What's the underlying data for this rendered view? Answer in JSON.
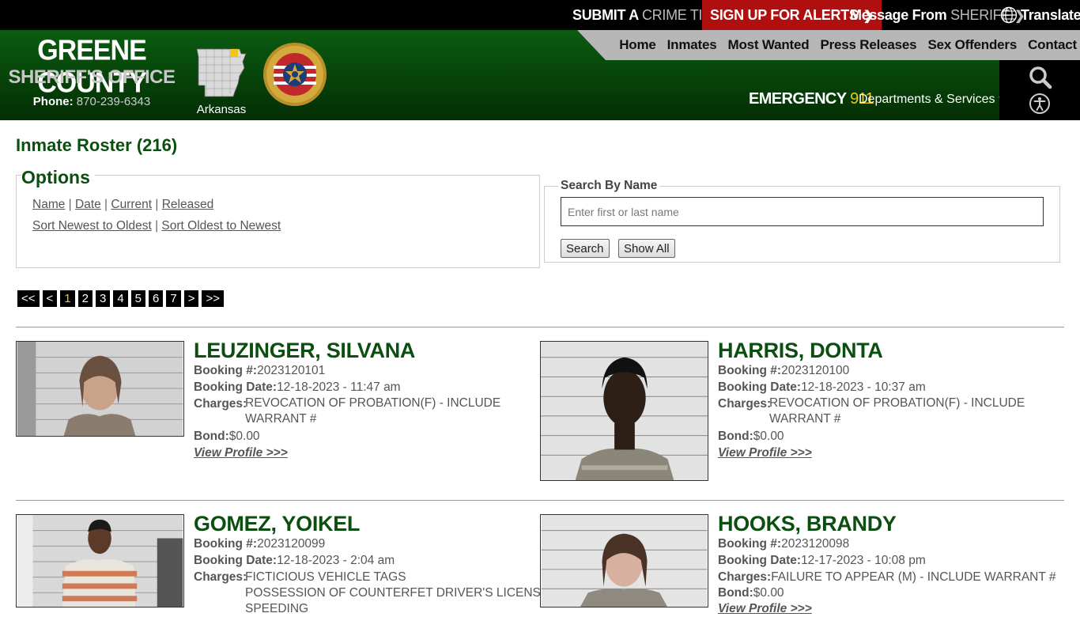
{
  "topbar": {
    "crime_tip_bold": "SUBMIT A",
    "crime_tip_muted": "CRIME TIP",
    "alerts": "SIGN UP FOR ALERTS",
    "sheriff_bold": "Message From",
    "sheriff_muted": "SHERIFF",
    "translate": "Translate"
  },
  "brand": {
    "title": "GREENE COUNTY",
    "subtitle": "SHERIFF'S OFFICE",
    "phone_label": "Phone:",
    "phone_number": "870-239-6343",
    "state_label": "Arkansas"
  },
  "nav": [
    "Home",
    "Inmates",
    "Most Wanted",
    "Press Releases",
    "Sex Offenders",
    "Contact"
  ],
  "emergency": {
    "label": "EMERGENCY",
    "number": "911"
  },
  "departments": "Departments & Services",
  "page": {
    "title": "Inmate Roster (216)"
  },
  "options": {
    "legend": "Options",
    "sort_links": [
      "Name",
      "Date",
      "Current",
      "Released"
    ],
    "order_links": [
      "Sort Newest to Oldest",
      "Sort Oldest to Newest"
    ]
  },
  "search": {
    "legend": "Search By Name",
    "placeholder": "Enter first or last name",
    "value": "",
    "search_label": "Search",
    "show_all_label": "Show All"
  },
  "pager": [
    "<<",
    "<",
    "1",
    "2",
    "3",
    "4",
    "5",
    "6",
    "7",
    ">",
    ">>"
  ],
  "pager_current": "1",
  "labels": {
    "booking_no": "Booking #:",
    "booking_date": "Booking Date:",
    "charges": "Charges:",
    "bond": "Bond:",
    "view_profile": "View Profile >>>"
  },
  "inmates": [
    {
      "name": "LEUZINGER, SILVANA",
      "booking_no": "2023120101",
      "booking_date": "12-18-2023 - 11:47 am",
      "charges": [
        "REVOCATION OF PROBATION(F) - INCLUDE WARRANT #"
      ],
      "bond": "$0.00"
    },
    {
      "name": "HARRIS, DONTA",
      "booking_no": "2023120100",
      "booking_date": "12-18-2023 - 10:37 am",
      "charges": [
        "REVOCATION OF PROBATION(F) - INCLUDE WARRANT #"
      ],
      "bond": "$0.00"
    },
    {
      "name": "GOMEZ, YOIKEL",
      "booking_no": "2023120099",
      "booking_date": "12-18-2023 - 2:04 am",
      "charges": [
        "FICTICIOUS VEHICLE TAGS",
        "POSSESSION OF COUNTERFET DRIVER'S LICENSE",
        "SPEEDING"
      ],
      "bond": ""
    },
    {
      "name": "HOOKS, BRANDY",
      "booking_no": "2023120098",
      "booking_date": "12-17-2023 - 10:08 pm",
      "charges": [
        "FAILURE TO APPEAR (M) - INCLUDE WARRANT #"
      ],
      "bond": "$0.00"
    }
  ]
}
